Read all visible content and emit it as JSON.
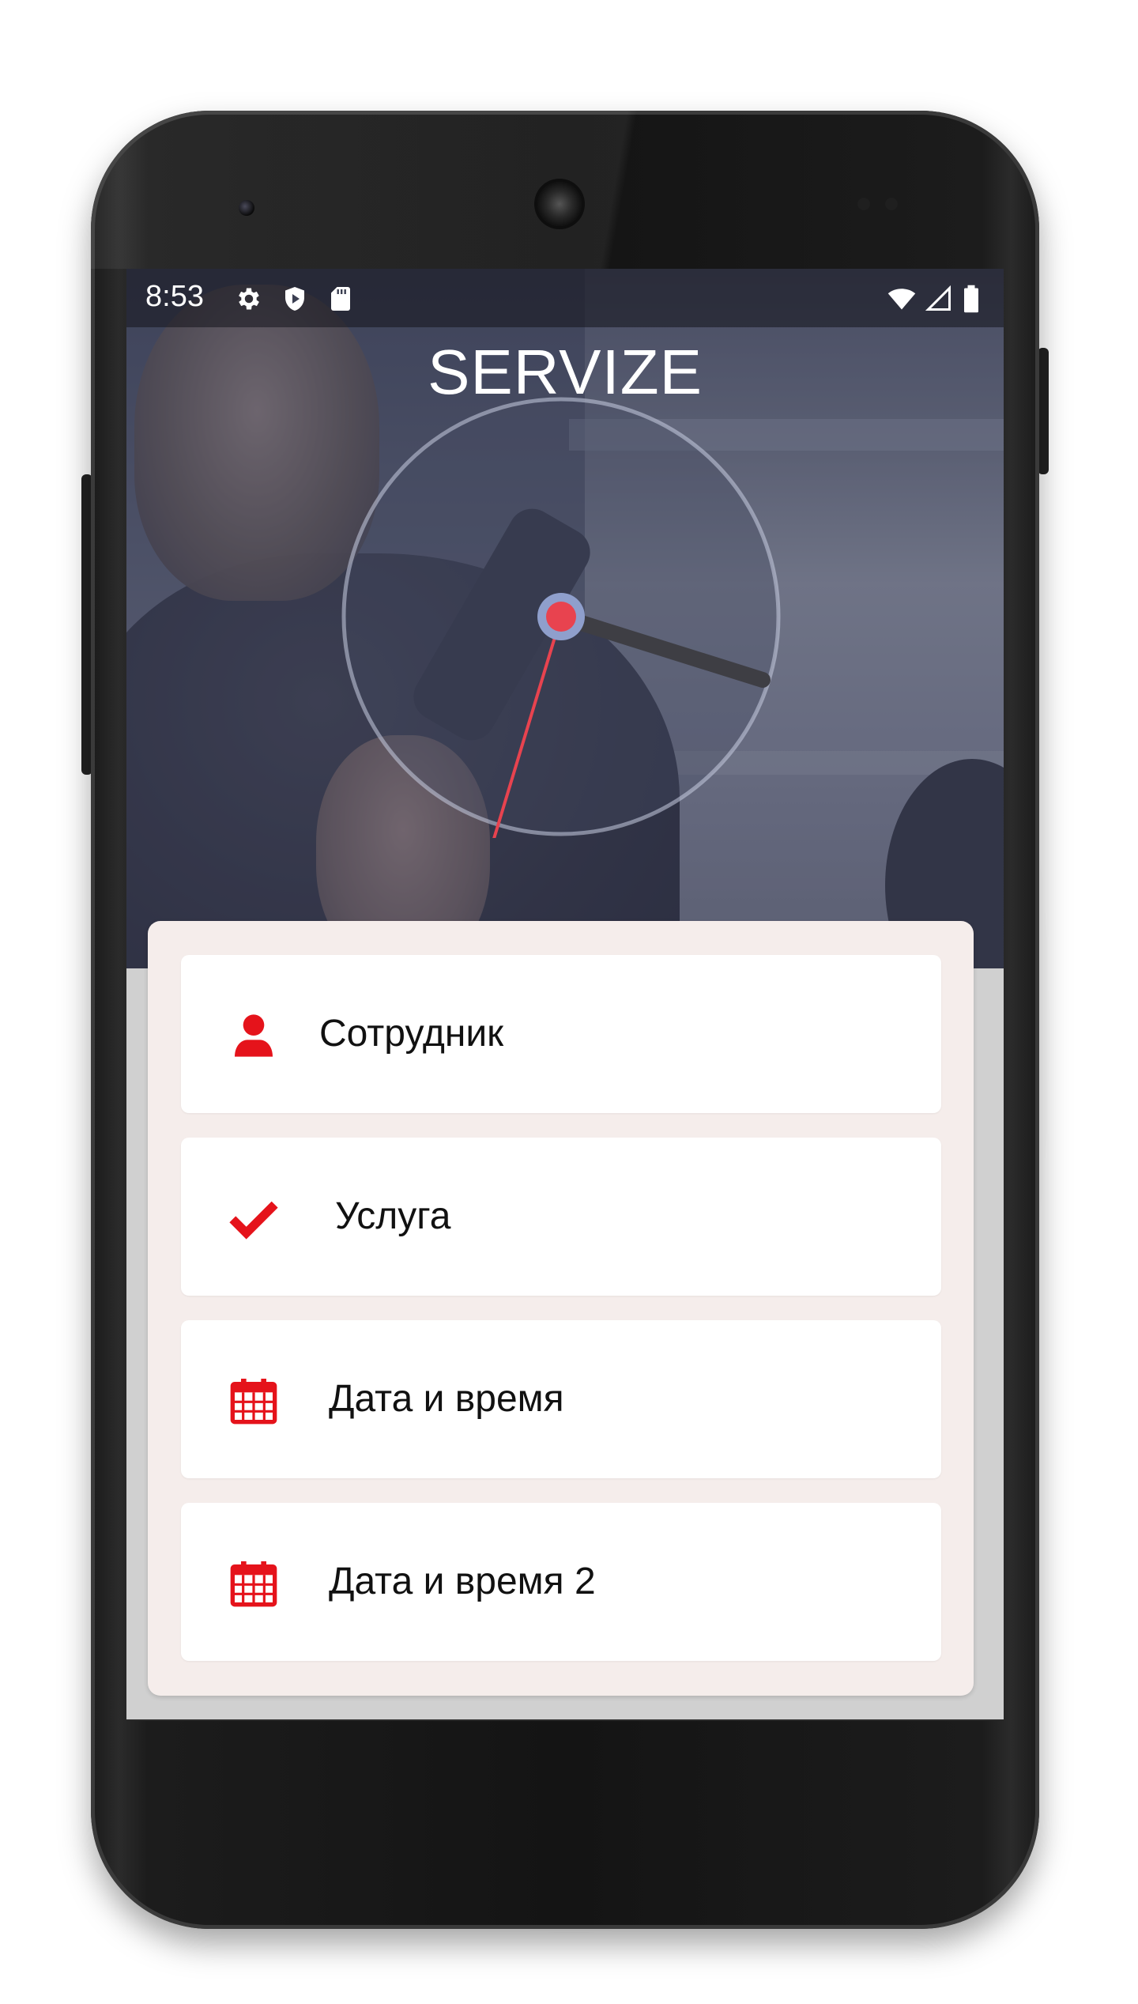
{
  "status_bar": {
    "time": "8:53",
    "left_icons": [
      "gear-icon",
      "play-shield-icon",
      "sd-card-icon"
    ],
    "right_icons": [
      "wifi-icon",
      "cell-signal-icon",
      "battery-icon"
    ]
  },
  "app": {
    "title": "SERVIZE"
  },
  "menu": {
    "items": [
      {
        "label": "Сотрудник",
        "icon": "person-icon"
      },
      {
        "label": "Услуга",
        "icon": "checkmark-icon"
      },
      {
        "label": "Дата и время",
        "icon": "calendar-icon"
      },
      {
        "label": "Дата и время 2",
        "icon": "calendar-icon"
      }
    ]
  },
  "colors": {
    "accent": "#e5131b",
    "card_panel": "#f5edeb",
    "screen_bg": "#d0d0d0",
    "clock_center": "#e8434f",
    "clock_ring": "#8f9fcc"
  }
}
